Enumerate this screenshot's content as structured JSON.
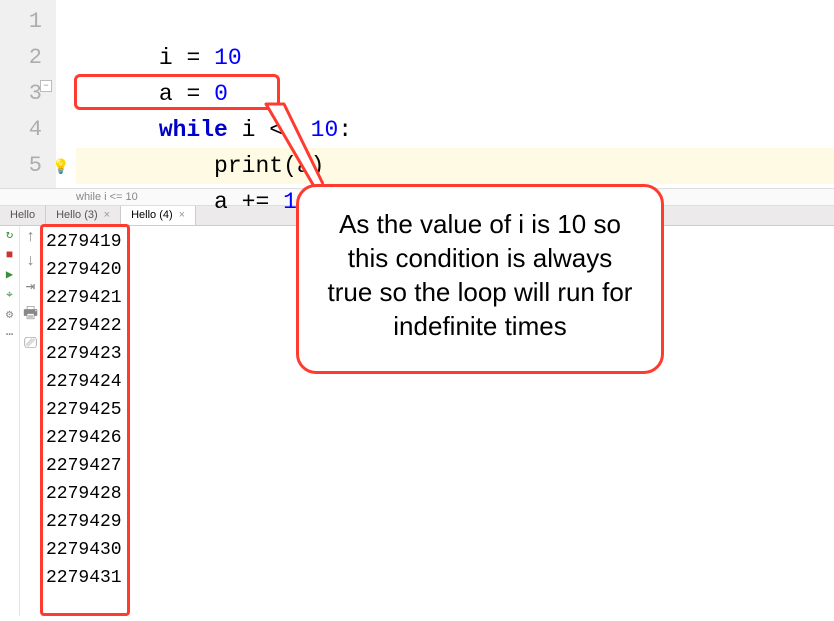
{
  "gutter": [
    "1",
    "2",
    "3",
    "4",
    "5"
  ],
  "code": {
    "l1": {
      "var": "i",
      "eq": " = ",
      "val": "10"
    },
    "l2": {
      "var": "a",
      "eq": " = ",
      "val": "0"
    },
    "l3": {
      "kw": "while",
      "mid": " i <= ",
      "val": "10",
      "colon": ":"
    },
    "l4": {
      "indent": "    ",
      "fn": "print",
      "args": "(a)"
    },
    "l5": {
      "indent": "    ",
      "var": "a += ",
      "val": "1"
    }
  },
  "breadcrumb": "while i <= 10",
  "tabs": [
    {
      "label": "Hello",
      "active": false
    },
    {
      "label": "Hello (3)",
      "active": false
    },
    {
      "label": "Hello (4)",
      "active": true
    }
  ],
  "close_glyph": "×",
  "toolcol1": {
    "rerun": "↻",
    "stop": "■",
    "play": "▶",
    "bug": "⌖",
    "gear": "⚙",
    "more": "⋯"
  },
  "toolcol2": {
    "up": "↑",
    "down": "↓",
    "wrap": "⇥",
    "print": "🖶",
    "clear": "⎚"
  },
  "console_output": [
    "2279419",
    "2279420",
    "2279421",
    "2279422",
    "2279423",
    "2279424",
    "2279425",
    "2279426",
    "2279427",
    "2279428",
    "2279429",
    "2279430",
    "2279431"
  ],
  "callout_text": "As the value of i is 10 so this condition is always true so the loop will run for indefinite times"
}
